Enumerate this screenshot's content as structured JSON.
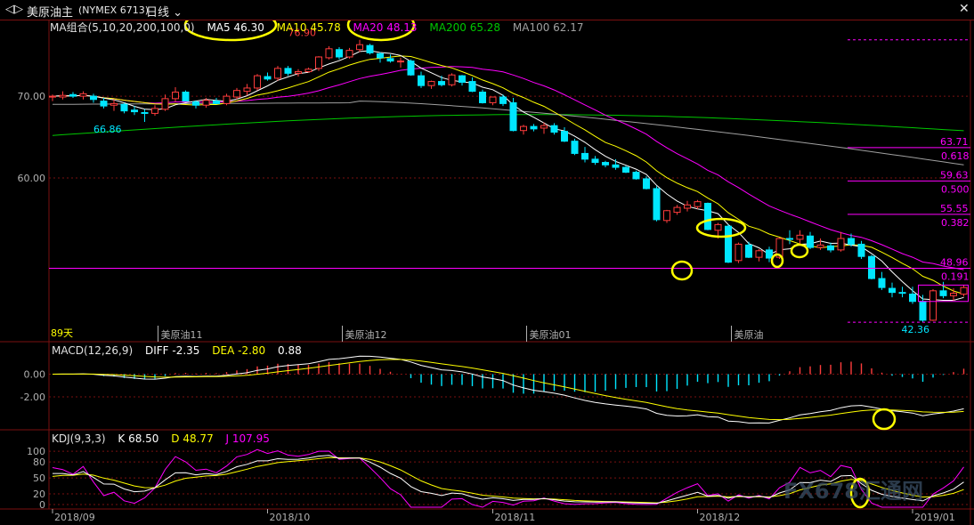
{
  "header": {
    "back_icon": "back-arrow-icon",
    "symbol": "美原油主",
    "code": "(NYMEX 6713)",
    "period": "日线",
    "dropdown_icon": "chevron-down-icon",
    "close_icon": "close-icon"
  },
  "colors": {
    "up": "#ff3c3c",
    "down": "#00e6ff",
    "grid": "#7a1010",
    "axis": "#b0b0b0",
    "ma5": "#ffffff",
    "ma10": "#ffff00",
    "ma20": "#ff00ff",
    "ma200": "#00c800",
    "ma100": "#a0a0a0",
    "macd_diff": "#ffffff",
    "macd_dea": "#ffff00",
    "kdj_k": "#ffffff",
    "kdj_d": "#ffff00",
    "kdj_j": "#ff00ff",
    "fib": "#ff00ff",
    "circle": "#ffff00"
  },
  "chart_data": [
    {
      "type": "candlestick",
      "legend": {
        "group": "MA组合(5,10,20,200,100,0)",
        "items": [
          {
            "name": "MA5",
            "value": "46.30"
          },
          {
            "name": "MA10",
            "value": "45.78"
          },
          {
            "name": "MA20",
            "value": "48.13"
          },
          {
            "name": "MA200",
            "value": "65.28"
          },
          {
            "name": "MA100",
            "value": "62.17"
          }
        ]
      },
      "y_ticks": [
        "70.00",
        "60.00"
      ],
      "ylim": [
        41.5,
        78.5
      ],
      "days": 90,
      "annotations": {
        "high": "76.90",
        "low_left": "66.86",
        "low": "42.36",
        "days_label": "89天"
      },
      "contract_labels": [
        {
          "text": "美原油11",
          "day": 11
        },
        {
          "text": "美原油12",
          "day": 29
        },
        {
          "text": "美原油01",
          "day": 47
        },
        {
          "text": "美原油",
          "day": 67
        }
      ],
      "fib_levels": [
        {
          "price": 63.71,
          "label": "63.71",
          "ratio": "0.618"
        },
        {
          "price": 59.63,
          "label": "59.63",
          "ratio": "0.500"
        },
        {
          "price": 55.55,
          "label": "55.55",
          "ratio": "0.382"
        },
        {
          "price": 48.96,
          "label": "48.96",
          "ratio": "0.191"
        }
      ],
      "fib_top": 76.9,
      "fib_bottom": 42.36,
      "candles": [
        [
          70.0,
          70.2,
          69.4,
          70.0
        ],
        [
          69.9,
          70.6,
          69.6,
          70.1
        ],
        [
          70.2,
          70.5,
          69.8,
          70.0
        ],
        [
          70.0,
          70.6,
          69.6,
          70.3
        ],
        [
          70.0,
          70.3,
          69.2,
          69.6
        ],
        [
          69.4,
          69.8,
          68.5,
          68.8
        ],
        [
          68.9,
          69.6,
          68.2,
          69.1
        ],
        [
          69.0,
          69.2,
          67.9,
          68.2
        ],
        [
          68.3,
          68.8,
          67.7,
          68.1
        ],
        [
          68.0,
          68.4,
          66.86,
          67.9
        ],
        [
          67.9,
          68.9,
          67.6,
          68.5
        ],
        [
          68.4,
          70.2,
          68.2,
          69.7
        ],
        [
          69.7,
          71.1,
          69.3,
          70.5
        ],
        [
          70.5,
          70.7,
          69.4,
          69.4
        ],
        [
          69.3,
          69.5,
          68.5,
          68.9
        ],
        [
          68.9,
          69.8,
          68.6,
          69.5
        ],
        [
          69.4,
          69.8,
          69.0,
          69.1
        ],
        [
          69.1,
          70.3,
          68.9,
          70.0
        ],
        [
          69.9,
          71.0,
          69.6,
          70.7
        ],
        [
          70.6,
          71.5,
          70.1,
          71.0
        ],
        [
          71.0,
          72.7,
          70.7,
          72.5
        ],
        [
          72.4,
          72.9,
          71.9,
          72.1
        ],
        [
          72.2,
          73.7,
          71.9,
          73.4
        ],
        [
          73.4,
          73.7,
          72.5,
          72.8
        ],
        [
          72.8,
          73.3,
          72.4,
          73.0
        ],
        [
          73.0,
          73.5,
          72.9,
          73.3
        ],
        [
          73.4,
          74.9,
          73.1,
          74.8
        ],
        [
          74.7,
          76.1,
          74.5,
          75.8
        ],
        [
          75.7,
          76.0,
          74.5,
          74.8
        ],
        [
          74.8,
          75.9,
          74.6,
          75.6
        ],
        [
          75.7,
          76.9,
          75.4,
          76.3
        ],
        [
          76.2,
          76.4,
          75.1,
          75.3
        ],
        [
          75.2,
          75.4,
          74.1,
          74.7
        ],
        [
          74.6,
          75.1,
          74.1,
          74.3
        ],
        [
          74.2,
          74.7,
          73.5,
          74.3
        ],
        [
          74.3,
          74.5,
          72.5,
          72.6
        ],
        [
          72.5,
          73.0,
          71.0,
          71.3
        ],
        [
          71.3,
          71.9,
          70.9,
          71.8
        ],
        [
          71.8,
          72.5,
          71.2,
          71.4
        ],
        [
          71.4,
          72.8,
          71.2,
          72.6
        ],
        [
          72.5,
          72.6,
          71.3,
          71.7
        ],
        [
          71.8,
          72.3,
          70.5,
          70.6
        ],
        [
          70.5,
          70.8,
          69.1,
          69.2
        ],
        [
          69.2,
          69.9,
          68.9,
          69.9
        ],
        [
          69.9,
          70.2,
          68.8,
          69.1
        ],
        [
          69.2,
          69.8,
          65.7,
          65.8
        ],
        [
          65.8,
          66.5,
          65.3,
          66.3
        ],
        [
          66.3,
          66.6,
          65.7,
          66.0
        ],
        [
          66.1,
          66.8,
          65.4,
          66.4
        ],
        [
          66.4,
          66.7,
          65.3,
          65.6
        ],
        [
          65.7,
          66.2,
          64.4,
          64.5
        ],
        [
          64.5,
          64.8,
          62.8,
          63.0
        ],
        [
          63.0,
          63.8,
          61.9,
          62.3
        ],
        [
          62.3,
          62.7,
          61.6,
          61.9
        ],
        [
          61.9,
          62.1,
          61.3,
          61.6
        ],
        [
          61.6,
          62.3,
          61.0,
          61.3
        ],
        [
          61.3,
          61.5,
          60.6,
          60.7
        ],
        [
          60.7,
          60.9,
          59.8,
          59.9
        ],
        [
          59.9,
          60.2,
          58.6,
          58.7
        ],
        [
          58.7,
          59.0,
          54.7,
          54.9
        ],
        [
          54.8,
          56.1,
          54.5,
          56.0
        ],
        [
          55.8,
          56.7,
          55.5,
          56.4
        ],
        [
          56.3,
          57.2,
          55.9,
          56.7
        ],
        [
          56.5,
          57.3,
          56.2,
          57.1
        ],
        [
          56.9,
          57.0,
          53.6,
          53.7
        ],
        [
          53.6,
          54.5,
          52.6,
          54.3
        ],
        [
          54.1,
          54.3,
          49.6,
          49.7
        ],
        [
          49.9,
          52.1,
          49.6,
          51.9
        ],
        [
          51.8,
          52.2,
          50.2,
          50.3
        ],
        [
          50.3,
          51.3,
          49.8,
          51.1
        ],
        [
          51.2,
          51.6,
          49.7,
          50.2
        ],
        [
          50.3,
          52.7,
          50.1,
          52.6
        ],
        [
          52.6,
          53.6,
          51.9,
          52.5
        ],
        [
          52.5,
          53.6,
          51.9,
          53.0
        ],
        [
          52.9,
          53.4,
          51.3,
          51.5
        ],
        [
          51.5,
          52.6,
          51.2,
          51.8
        ],
        [
          51.7,
          52.1,
          50.9,
          51.2
        ],
        [
          51.2,
          53.4,
          51.0,
          52.6
        ],
        [
          52.6,
          53.2,
          51.6,
          51.9
        ],
        [
          51.9,
          52.3,
          50.1,
          50.4
        ],
        [
          50.4,
          50.6,
          47.6,
          47.7
        ],
        [
          47.7,
          48.5,
          46.3,
          46.6
        ],
        [
          46.5,
          47.2,
          45.4,
          46.0
        ],
        [
          46.0,
          46.7,
          45.4,
          45.9
        ],
        [
          45.8,
          46.7,
          44.6,
          44.9
        ],
        [
          44.9,
          45.7,
          42.36,
          42.6
        ],
        [
          42.6,
          46.4,
          42.5,
          46.2
        ],
        [
          46.2,
          47.3,
          45.3,
          45.6
        ],
        [
          45.6,
          46.5,
          45.0,
          45.9
        ],
        [
          45.8,
          46.9,
          45.5,
          46.6
        ]
      ]
    },
    {
      "type": "bar",
      "title": "MACD(12,26,9)",
      "items": [
        {
          "name": "DIFF",
          "value": "-2.35"
        },
        {
          "name": "DEA",
          "value": "-2.80"
        },
        {
          "name": "",
          "value": "0.88"
        }
      ],
      "y_ticks": [
        "0.00",
        "-2.00"
      ],
      "ylim": [
        -4.5,
        1.6
      ]
    },
    {
      "type": "line",
      "title": "KDJ(9,3,3)",
      "items": [
        {
          "name": "K",
          "value": "68.50"
        },
        {
          "name": "D",
          "value": "48.77"
        },
        {
          "name": "J",
          "value": "107.95"
        }
      ],
      "y_ticks": [
        "100",
        "80",
        "50",
        "20",
        "0"
      ],
      "ylim": [
        -5,
        112
      ]
    }
  ],
  "x_axis": {
    "labels": [
      {
        "text": "2018/09",
        "day": 0
      },
      {
        "text": "2018/10",
        "day": 21
      },
      {
        "text": "2018/11",
        "day": 43
      },
      {
        "text": "2018/12",
        "day": 63
      },
      {
        "text": "2019/01",
        "day": 84
      }
    ]
  },
  "watermark": "FX678汇通网"
}
